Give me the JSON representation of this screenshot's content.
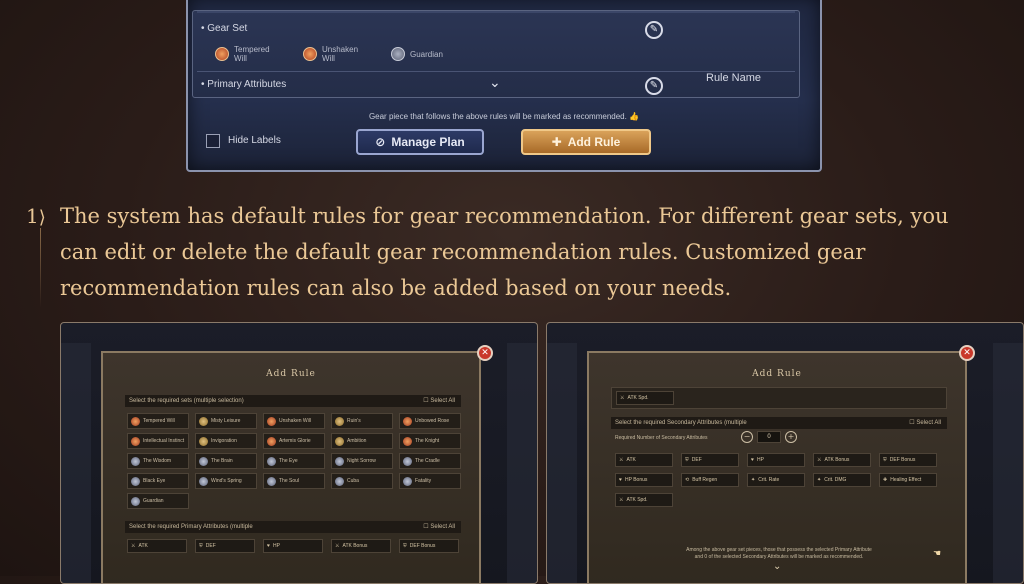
{
  "top_panel": {
    "gear_set_label": "Gear Set",
    "gear_items": [
      {
        "name": "Tempered Will",
        "icon": "gear-set-icon"
      },
      {
        "name": "Unshaken Will",
        "icon": "gear-set-icon"
      },
      {
        "name": "Guardian",
        "icon": "gear-set-icon"
      }
    ],
    "primary_attributes_label": "Primary Attributes",
    "rule_name_label": "Rule Name",
    "note": "Gear piece that follows the above rules will be marked as recommended.",
    "hide_labels": "Hide Labels",
    "manage_plan": "Manage Plan",
    "add_rule": "Add Rule"
  },
  "step": {
    "number": "1",
    "text": "The system has default rules for gear recommendation. For different gear sets, you can edit or delete the default gear recommendation rules. Customized gear recommendation rules can also be added based on your needs."
  },
  "left_dialog": {
    "title": "Add Rule",
    "sets_header": "Select the required sets (multiple selection)",
    "select_all": "Select All",
    "sets": [
      [
        "Tempered Will",
        "Misty Leisure",
        "Unshaken Will",
        "Ruin's",
        "Unbowed Rose"
      ],
      [
        "Intellectual Instinct",
        "Invigoration",
        "Artemis Glorie",
        "Ambition",
        "The Knight"
      ],
      [
        "The Wisdom",
        "The Brain",
        "The Eye",
        "Night Sorrow",
        "The Cradle"
      ],
      [
        "Black Eye",
        "Wind's Spring",
        "The Soul",
        "Cuba",
        "Fatality"
      ],
      [
        "Guardian"
      ]
    ],
    "primary_header": "Select the required Primary Attributes (multiple",
    "primary_select_all": "Select All",
    "primary_attrs": [
      "ATK",
      "DEF",
      "HP",
      "ATK Bonus",
      "DEF Bonus"
    ]
  },
  "right_dialog": {
    "title": "Add Rule",
    "selected_attr": "ATK Spd.",
    "secondary_header": "Select the required Secondary Attributes (multiple",
    "select_all": "Select All",
    "required_number_label": "Required Number of Secondary Attributes",
    "required_number_value": "0",
    "secondary_attrs": [
      "ATK",
      "DEF",
      "HP",
      "ATK Bonus",
      "DEF Bonus",
      "HP Bonus",
      "Buff Regen",
      "Crit. Rate",
      "Crit. DMG",
      "Healing Effect",
      "ATK Spd."
    ],
    "note_line1": "Among the above gear set pieces, those that possess the selected Primary Attribute",
    "note_line2": "and 0 of the selected Secondary Attributes will be marked as recommended."
  },
  "colors": {
    "accent_gold": "#ebc896",
    "panel_blue": "#252f4d",
    "close_red": "#c9382a"
  }
}
